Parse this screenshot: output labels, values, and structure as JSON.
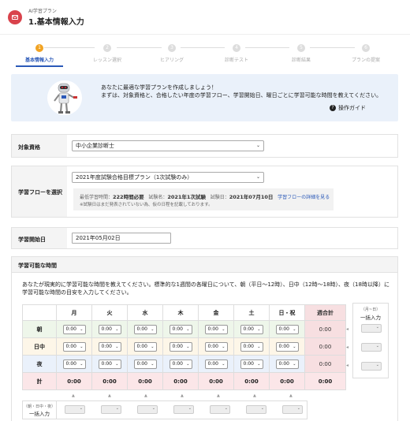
{
  "header": {
    "subtitle": "AI学習プラン",
    "title": "1.基本情報入力"
  },
  "steps": [
    {
      "num": "1",
      "label": "基本情報入力"
    },
    {
      "num": "2",
      "label": "レッスン選択"
    },
    {
      "num": "3",
      "label": "ヒアリング"
    },
    {
      "num": "4",
      "label": "診断テスト"
    },
    {
      "num": "5",
      "label": "診断結果"
    },
    {
      "num": "6",
      "label": "プランの提案"
    }
  ],
  "guide": {
    "line1": "あなたに最適な学習プランを作成しましょう！",
    "line2": "まずは、対象資格と、合格したい年度の学習フロー、学習開始日、曜日ごとに学習可能な時間を教えてください。",
    "help_icon": "?",
    "help_label": "操作ガイド"
  },
  "qualification": {
    "label": "対象資格",
    "value": "中小企業診断士"
  },
  "flow": {
    "label": "学習フローを選択",
    "value": "2021年度試験合格目標プラン（1次試験のみ）",
    "hours_label": "最低学習時間：",
    "hours_value": "222時間必要",
    "exam_label": "試験名：",
    "exam_value": "2021年1次試験",
    "date_label": "試験日：",
    "date_value": "2021年07月10日",
    "link": "学習フローの詳細を見る",
    "note": "※試験日はまだ発表されていない為、仮の日程を記載しております。"
  },
  "start": {
    "label": "学習開始日",
    "value": "2021年05月02日"
  },
  "availability": {
    "title": "学習可能な時間",
    "desc1": "あなたが現実的に学習可能な時間を教えてください。標準的な1週間の各曜日について、朝（平日〜12時）、日中（12時〜18時）、夜（18時以降）に",
    "desc2": "学習可能な時間の目安を入力してください。",
    "days": [
      "月",
      "火",
      "水",
      "木",
      "金",
      "土",
      "日・祝"
    ],
    "total_header": "週合計",
    "rows": [
      {
        "label": "朝",
        "values": [
          "0:00",
          "0:00",
          "0:00",
          "0:00",
          "0:00",
          "0:00",
          "0:00"
        ],
        "total": "0:00"
      },
      {
        "label": "日中",
        "values": [
          "0:00",
          "0:00",
          "0:00",
          "0:00",
          "0:00",
          "0:00",
          "0:00"
        ],
        "total": "0:00"
      },
      {
        "label": "夜",
        "values": [
          "0:00",
          "0:00",
          "0:00",
          "0:00",
          "0:00",
          "0:00",
          "0:00"
        ],
        "total": "0:00"
      }
    ],
    "sum_row": {
      "label": "計",
      "values": [
        "0:00",
        "0:00",
        "0:00",
        "0:00",
        "0:00",
        "0:00",
        "0:00"
      ],
      "total": "0:00"
    },
    "bulk_right": {
      "sub": "（月~日）",
      "label": "一括入力"
    },
    "bulk_bottom": {
      "sub": "（朝・日中・夜）",
      "label": "一括入力"
    },
    "left_arrow": "◂",
    "up_arrow": "▲"
  }
}
